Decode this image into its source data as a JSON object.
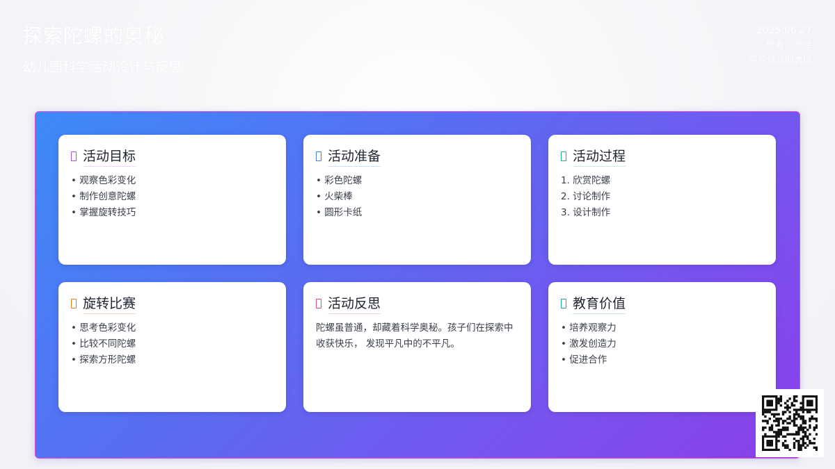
{
  "header": {
    "title": "探索陀螺的奥秘",
    "subtitle": "幼儿园科学活动设计与反思",
    "date": "2025.06.27",
    "names": [
      "作者",
      "张晓"
    ],
    "school": "实验幼儿园大班"
  },
  "cards": [
    {
      "title": "活动目标",
      "accent": "#b44cd9",
      "underline": "#f3d6fb",
      "items": [
        "• 观察色彩变化",
        "• 制作创意陀螺",
        "• 掌握旋转技巧"
      ]
    },
    {
      "title": "活动准备",
      "accent": "#3b7fe0",
      "underline": "#cfe2fb",
      "items": [
        "• 彩色陀螺",
        "• 火柴棒",
        "• 圆形卡纸"
      ]
    },
    {
      "title": "活动过程",
      "accent": "#1fb37a",
      "underline": "#c9efdf",
      "items": [
        "1. 欣赏陀螺",
        "2. 讨论制作",
        "3. 设计制作"
      ]
    },
    {
      "title": "旋转比赛",
      "accent": "#ea7b1a",
      "underline": "#fbdcc2",
      "items": [
        "• 思考色彩变化",
        "• 比较不同陀螺",
        "• 探索方形陀螺"
      ]
    },
    {
      "title": "活动反思",
      "accent": "#e0478a",
      "underline": "#fbd3e4",
      "text": "陀螺虽普通，却藏着科学奥秘。孩子们在探索中收获快乐， 发现平凡中的不平凡。"
    },
    {
      "title": "教育价值",
      "accent": "#1aa6a6",
      "underline": "#c5ecec",
      "items": [
        "• 培养观察力",
        "• 激发创造力",
        "• 促进合作"
      ]
    }
  ],
  "colors": {
    "panel_gradient": [
      "#3d8af7",
      "#8a3ee8"
    ],
    "panel_border": "#d64fd0"
  },
  "icons": {
    "card_icon": "square-outline-icon",
    "qr": "qr-code"
  }
}
